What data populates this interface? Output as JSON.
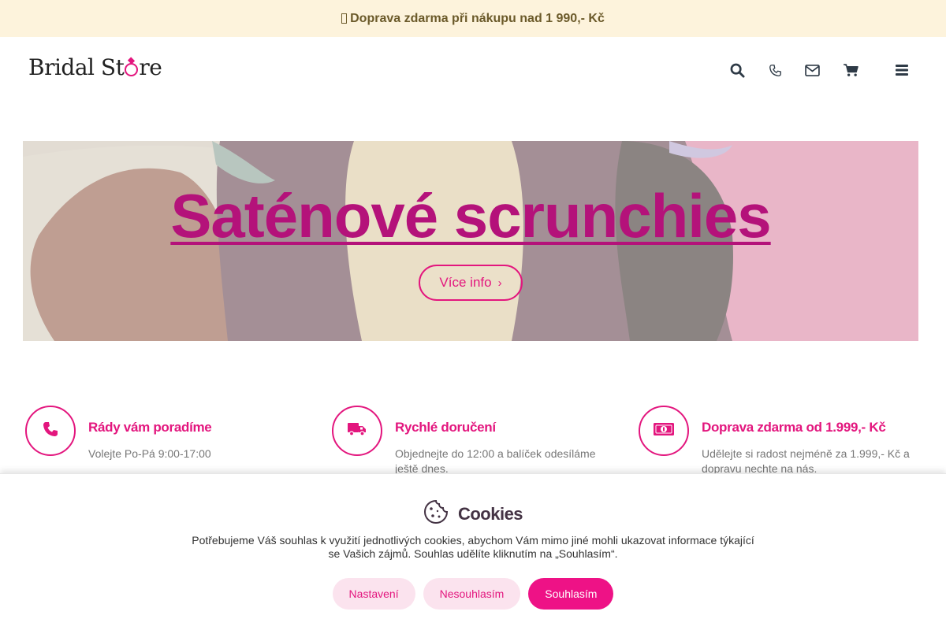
{
  "topbar": {
    "text": "Doprava zdarma při nákupu nad 1 990,- Kč"
  },
  "header": {
    "logo_text_before": "Bridal St",
    "logo_text_after": "re",
    "icons": [
      "search-icon",
      "phone-icon",
      "envelope-icon",
      "cart-icon",
      "menu-icon"
    ]
  },
  "hero": {
    "title": "Saténové scrunchies",
    "button_label": "Více info",
    "button_chevron": "›"
  },
  "features": [
    {
      "icon": "phone-icon",
      "title": "Rády vám poradíme",
      "text": "Volejte Po-Pá 9:00-17:00"
    },
    {
      "icon": "truck-icon",
      "title": "Rychlé doručení",
      "text": "Objednejte do 12:00 a balíček odesíláme ještě dnes."
    },
    {
      "icon": "money-icon",
      "title": "Doprava zdarma od 1.999,- Kč",
      "text": "Udělejte si radost nejméně za 1.999,- Kč a dopravu nechte na nás."
    }
  ],
  "cookies": {
    "title": "Cookies",
    "text": "Potřebujeme Váš souhlas k využití jednotlivých cookies, abychom Vám mimo jiné mohli ukazovat informace týkající se Vašich zájmů. Souhlas udělíte kliknutím na „Souhlasím“.",
    "settings_label": "Nastavení",
    "decline_label": "Nesouhlasím",
    "accept_label": "Souhlasím"
  },
  "colors": {
    "accent": "#e3167e",
    "topbar_bg": "#fdf3dc",
    "hero_title": "#b4127a"
  }
}
